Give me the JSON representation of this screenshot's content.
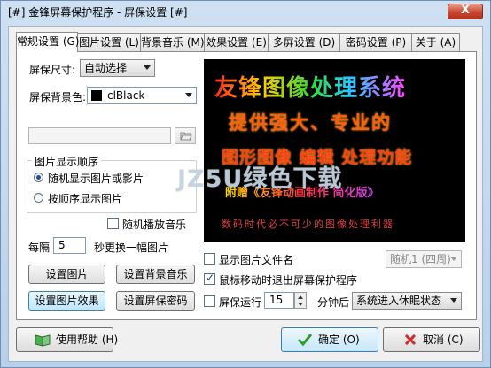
{
  "window": {
    "title": "[#] 金锋屏幕保护程序 - 屏保设置 [#]",
    "close_glyph": "X",
    "accent": "#b8d0ea"
  },
  "tabs": [
    {
      "label": "常规设置 (G)",
      "active": true
    },
    {
      "label": "图片设置 (L)",
      "active": false
    },
    {
      "label": "背景音乐 (M)",
      "active": false
    },
    {
      "label": "效果设置 (E)",
      "active": false
    },
    {
      "label": "多屏设置 (D)",
      "active": false
    },
    {
      "label": "密码设置 (P)",
      "active": false
    },
    {
      "label": "关于 (A)",
      "active": false
    }
  ],
  "general": {
    "size_label": "屏保尺寸:",
    "size_value": "自动选择",
    "bg_label": "屏保背景色:",
    "bg_value": "clBlack",
    "bg_color": "#000000",
    "picture_order_group": "图片显示顺序",
    "order_random": "随机显示图片或影片",
    "order_sequential": "按顺序显示图片",
    "random_music": "随机播放音乐",
    "interval_prefix": "每隔",
    "interval_value": "5",
    "interval_suffix": "秒更换一幅图片"
  },
  "buttons": {
    "set_picture": "设置图片",
    "set_bg_music": "设置背景音乐",
    "set_picture_effect": "设置图片效果",
    "set_password": "设置屏保密码"
  },
  "preview": {
    "line1": "友锋图像处理系统",
    "line2": "提供强大、专业的",
    "line3": "图形图像 编辑 处理功能",
    "line4": "附赠《友锋动画制作 简化版》",
    "line5": "数码时代必不可少的图像处理利器"
  },
  "watermark": "JZ5U绿色下载",
  "options": {
    "show_filename": "显示图片文件名",
    "filename_position": "随机1 (四周)",
    "exit_on_mouse": "鼠标移动时退出屏幕保护程序",
    "screensaver_run": "屏保运行",
    "run_minutes": "15",
    "minutes_after": "分钟后",
    "after_action": "系统进入休眠状态"
  },
  "footer": {
    "help": "使用帮助 (H)",
    "ok": "确定 (O)",
    "cancel": "取消 (C)"
  }
}
